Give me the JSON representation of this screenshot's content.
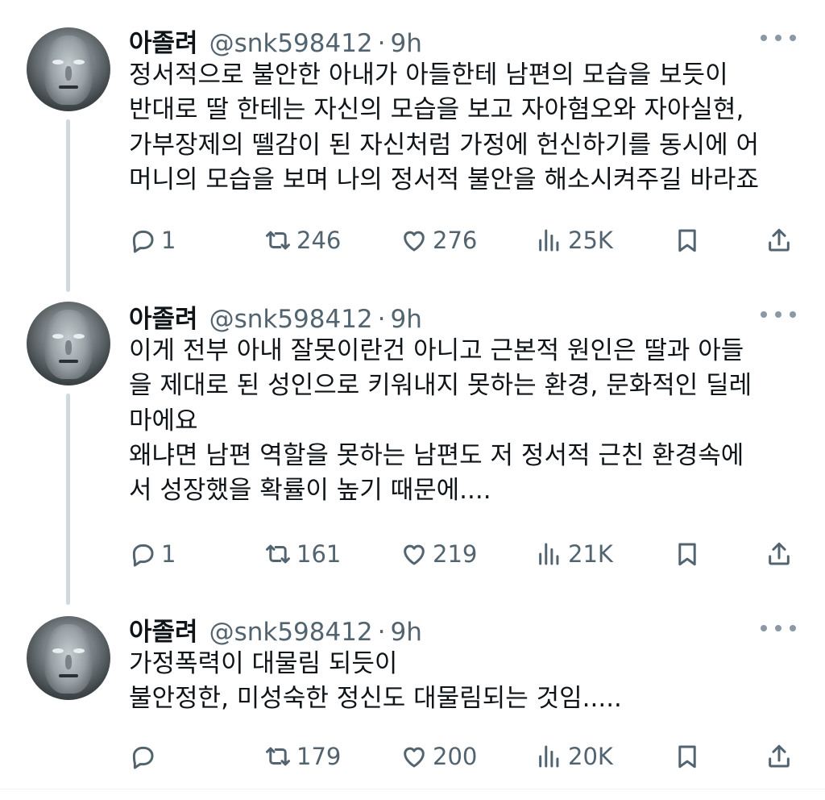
{
  "tweets": [
    {
      "name": "아졸려",
      "handle": "@snk598412",
      "separator": "·",
      "time": "9h",
      "lines": [
        "정서적으로 불안한 아내가 아들한테 남편의 모습을 보듯이",
        "반대로 딸 한테는 자신의 모습을 보고 자아혐오와 자아실현,",
        "가부장제의 뗄감이 된 자신처럼 가정에 헌신하기를 동시에 어",
        "머니의 모습을 보며 나의 정서적 불안을 해소시켜주길 바라죠"
      ],
      "replies": "1",
      "retweets": "246",
      "likes": "276",
      "views": "25K"
    },
    {
      "name": "아졸려",
      "handle": "@snk598412",
      "separator": "·",
      "time": "9h",
      "lines": [
        "이게 전부 아내 잘못이란건 아니고 근본적 원인은 딸과 아들",
        "을 제대로 된 성인으로 키워내지 못하는 환경, 문화적인 딜레",
        "마에요",
        "왜냐면 남편 역할을 못하는 남편도 저 정서적 근친 환경속에",
        "서 성장했을 확률이 높기 때문에...."
      ],
      "replies": "1",
      "retweets": "161",
      "likes": "219",
      "views": "21K"
    },
    {
      "name": "아졸려",
      "handle": "@snk598412",
      "separator": "·",
      "time": "9h",
      "lines": [
        "가정폭력이 대물림 되듯이",
        "불안정한, 미성숙한 정신도 대물림되는 것임....."
      ],
      "replies": "",
      "retweets": "179",
      "likes": "200",
      "views": "20K"
    }
  ],
  "icons": {
    "reply": "reply-icon",
    "retweet": "retweet-icon",
    "like": "heart-icon",
    "views": "views-icon",
    "bookmark": "bookmark-icon",
    "share": "share-icon",
    "more": "more-icon"
  },
  "colors": {
    "text": "#0f1419",
    "secondary": "#536471",
    "thread_line": "#cfd9de"
  }
}
